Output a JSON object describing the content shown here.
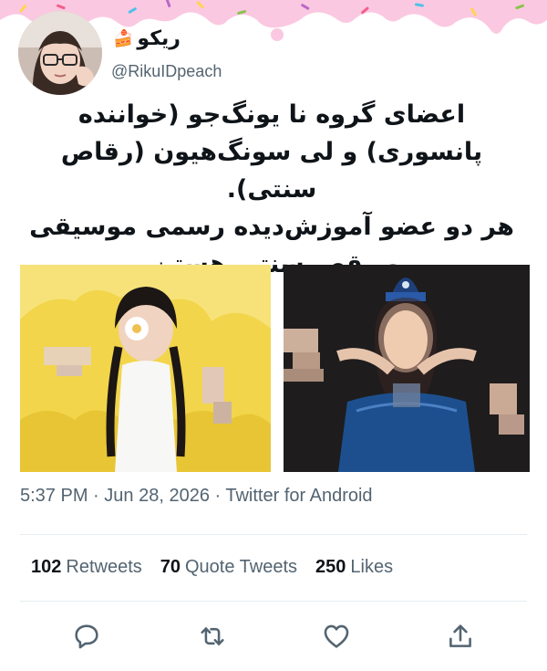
{
  "colors": {
    "drip": "#fbc8e1",
    "sprinkle_colors": [
      "#f25f8a",
      "#4fc1e9",
      "#ffd54f",
      "#8bc34a",
      "#ba68c8"
    ],
    "handle_gray": "#536471",
    "text_dark": "#0f1419",
    "divider": "#e6ecf0"
  },
  "user": {
    "display_name": "ریکو",
    "name_emoji": "🍰",
    "handle": "@RikuIDpeach",
    "avatar_icon": "profile-photo"
  },
  "tweet": {
    "lines": [
      "اعضای گروه نا یونگ‌جو (خواننده",
      "پانسوری) و لی سونگ‌هیون (رقاص سنتی).",
      "هر دو عضو آموزش‌دیده رسمی موسیقی",
      "و رقص سنتی هستن."
    ]
  },
  "media": [
    {
      "name": "photo-yellow-background"
    },
    {
      "name": "photo-blue-dress"
    }
  ],
  "meta": {
    "time": "5:37 PM",
    "separator": "·",
    "date": "Jun 28, 2026",
    "source": "Twitter for Android"
  },
  "stats": {
    "retweets_count": "102",
    "retweets_label": "Retweets",
    "quotes_count": "70",
    "quotes_label": "Quote Tweets",
    "likes_count": "250",
    "likes_label": "Likes"
  },
  "actions": [
    {
      "name": "reply-icon"
    },
    {
      "name": "retweet-icon"
    },
    {
      "name": "like-icon"
    },
    {
      "name": "share-icon"
    }
  ]
}
